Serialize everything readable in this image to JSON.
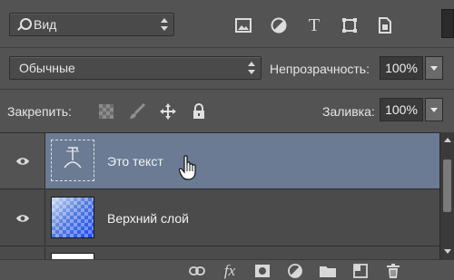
{
  "filter": {
    "kind_label": "Вид",
    "icons": [
      "pixel-layer-filter-icon",
      "adjustment-layer-filter-icon",
      "type-layer-filter-icon",
      "shape-layer-filter-icon",
      "smart-object-filter-icon"
    ],
    "type_icon_glyph": "T"
  },
  "blend": {
    "mode_label": "Обычные",
    "opacity_label": "Непрозрачность:",
    "opacity_value": "100%"
  },
  "lock": {
    "label": "Закрепить:",
    "icons": [
      "lock-transparent-pixels-icon",
      "lock-image-pixels-icon",
      "lock-position-icon",
      "lock-all-icon"
    ],
    "fill_label": "Заливка:",
    "fill_value": "100%"
  },
  "layers": [
    {
      "name": "Это текст",
      "kind": "text",
      "visible": true,
      "selected": true
    },
    {
      "name": "Верхний слой",
      "kind": "gradient",
      "visible": true,
      "selected": false
    }
  ],
  "bottom": {
    "fx_label": "fx",
    "icons": [
      "link-layers-icon",
      "layer-style-icon",
      "add-mask-icon",
      "adjustment-layer-icon",
      "group-folder-icon",
      "new-layer-icon",
      "trash-icon"
    ]
  },
  "colors": {
    "panel_bg": "#535353",
    "selected_row": "#6a7b93",
    "gradient_blue": "#1746ff"
  }
}
